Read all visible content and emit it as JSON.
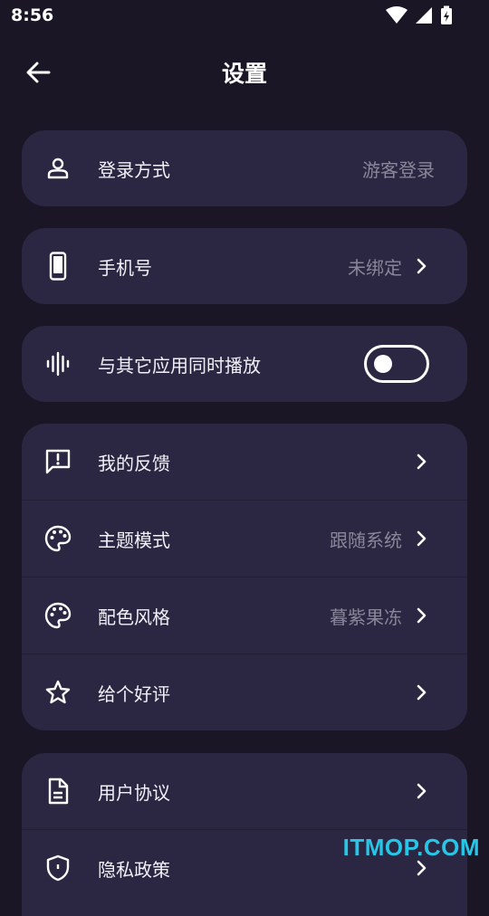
{
  "status": {
    "time": "8:56"
  },
  "header": {
    "title": "设置"
  },
  "rows": {
    "login": {
      "label": "登录方式",
      "value": "游客登录"
    },
    "phone": {
      "label": "手机号",
      "value": "未绑定"
    },
    "mix": {
      "label": "与其它应用同时播放",
      "toggle": false
    },
    "feedback": {
      "label": "我的反馈"
    },
    "theme": {
      "label": "主题模式",
      "value": "跟随系统"
    },
    "color": {
      "label": "配色风格",
      "value": "暮紫果冻"
    },
    "rate": {
      "label": "给个好评"
    },
    "agreement": {
      "label": "用户协议"
    },
    "privacy": {
      "label": "隐私政策"
    }
  },
  "watermark": "ITMOP.COM",
  "colors": {
    "background": "#1a1626",
    "card": "#2b2742",
    "secondary_text": "#8a869a",
    "watermark": "#27c5e6"
  }
}
